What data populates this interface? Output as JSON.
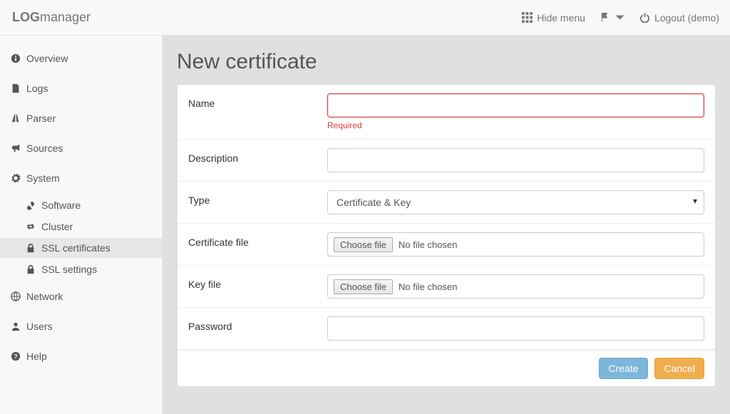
{
  "brand": {
    "bold": "LOG",
    "rest": "manager"
  },
  "topbar": {
    "hide_menu": "Hide menu",
    "logout": "Logout (demo)"
  },
  "sidebar": {
    "items": [
      {
        "label": "Overview"
      },
      {
        "label": "Logs"
      },
      {
        "label": "Parser"
      },
      {
        "label": "Sources"
      },
      {
        "label": "System"
      },
      {
        "label": "Network"
      },
      {
        "label": "Users"
      },
      {
        "label": "Help"
      }
    ],
    "system_sub": [
      {
        "label": "Software"
      },
      {
        "label": "Cluster"
      },
      {
        "label": "SSL certificates"
      },
      {
        "label": "SSL settings"
      }
    ]
  },
  "page": {
    "title": "New certificate"
  },
  "form": {
    "name": {
      "label": "Name",
      "value": "",
      "error": "Required"
    },
    "description": {
      "label": "Description",
      "value": ""
    },
    "type": {
      "label": "Type",
      "value": "Certificate & Key"
    },
    "certfile": {
      "label": "Certificate file",
      "button": "Choose file",
      "status": "No file chosen"
    },
    "keyfile": {
      "label": "Key file",
      "button": "Choose file",
      "status": "No file chosen"
    },
    "password": {
      "label": "Password",
      "value": ""
    }
  },
  "buttons": {
    "create": "Create",
    "cancel": "Cancel"
  }
}
